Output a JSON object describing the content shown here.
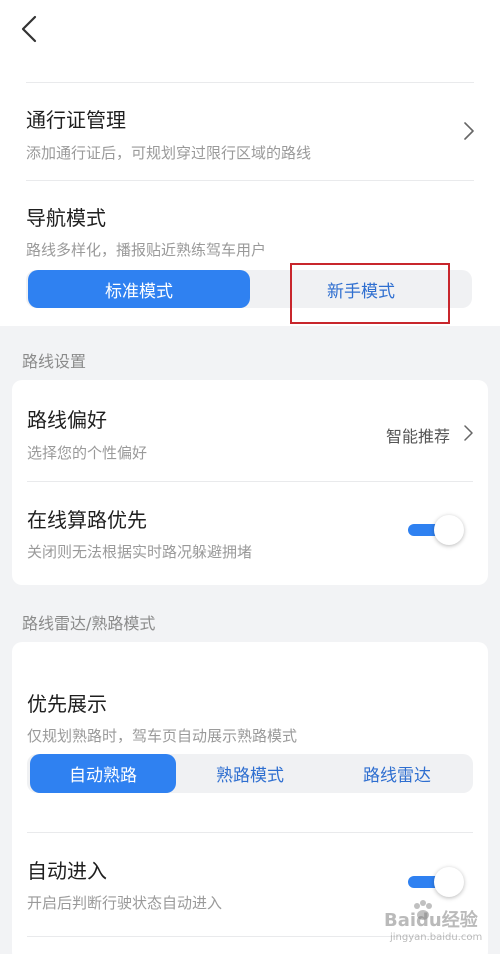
{
  "permit": {
    "title": "通行证管理",
    "subtitle": "添加通行证后，可规划穿过限行区域的路线"
  },
  "nav_mode": {
    "title": "导航模式",
    "subtitle": "路线多样化，播报贴近熟练驾车用户",
    "options": [
      "标准模式",
      "新手模式"
    ],
    "selected": "标准模式"
  },
  "route_settings": {
    "section_label": "路线设置",
    "preference": {
      "title": "路线偏好",
      "subtitle": "选择您的个性偏好",
      "value": "智能推荐"
    },
    "online_calc": {
      "title": "在线算路优先",
      "subtitle": "关闭则无法根据实时路况躲避拥堵",
      "enabled": true
    }
  },
  "radar": {
    "section_label": "路线雷达/熟路模式",
    "priority": {
      "title": "优先展示",
      "subtitle": "仅规划熟路时，驾车页自动展示熟路模式",
      "options": [
        "自动熟路",
        "熟路模式",
        "路线雷达"
      ],
      "selected": "自动熟路"
    },
    "auto_enter": {
      "title": "自动进入",
      "subtitle": "开启后判断行驶状态自动进入",
      "enabled": true
    }
  },
  "watermark": {
    "brand": "Baidu经验",
    "url": "jingyan.baidu.com"
  },
  "colors": {
    "accent": "#2f81f1",
    "highlight": "#c8262c"
  }
}
